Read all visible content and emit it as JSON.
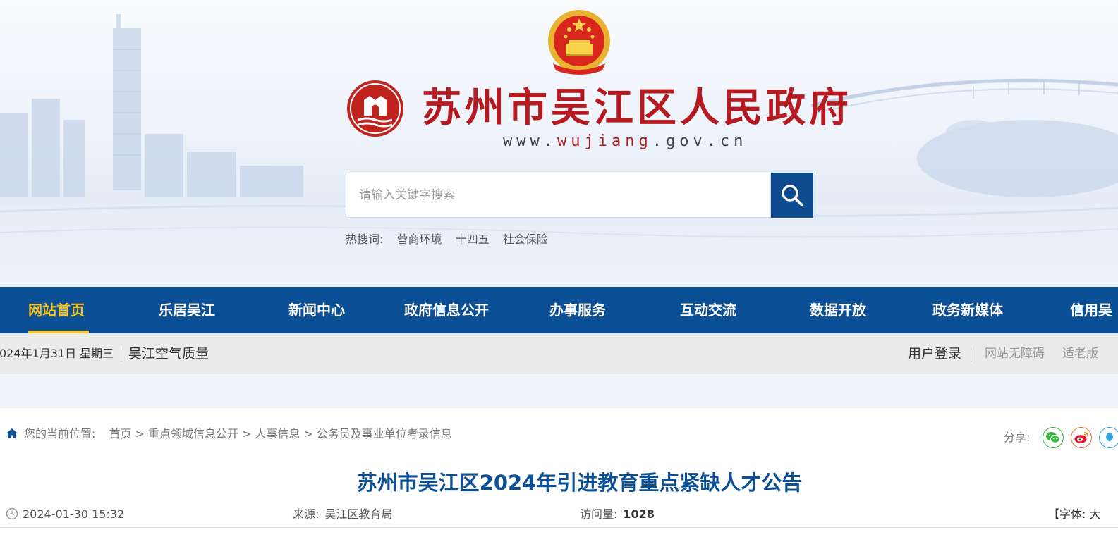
{
  "header": {
    "site_name": "苏州市吴江区人民政府",
    "url_prefix": "www.",
    "url_highlight": "wujiang",
    "url_suffix": ".gov.cn",
    "search_placeholder": "请输入关键字搜索",
    "hot_label": "热搜词:",
    "hot_words": [
      "营商环境",
      "十四五",
      "社会保险"
    ]
  },
  "nav": {
    "items": [
      "网站首页",
      "乐居吴江",
      "新闻中心",
      "政府信息公开",
      "办事服务",
      "互动交流",
      "数据开放",
      "政务新媒体",
      "信用吴"
    ],
    "active": "网站首页"
  },
  "infobar": {
    "date": "024年1月31日 星期三",
    "air_quality": "吴江空气质量",
    "login": "用户登录",
    "accessibility": "网站无障碍",
    "elder_version": "适老版"
  },
  "breadcrumb": {
    "label": "您的当前位置:",
    "items": [
      "首页",
      "重点领域信息公开",
      "人事信息",
      "公务员及事业单位考录信息"
    ],
    "separator": ">"
  },
  "share": {
    "label": "分享:",
    "icons": [
      "wechat-icon",
      "weibo-icon",
      "qq-icon"
    ]
  },
  "article": {
    "title": "苏州市吴江区2024年引进教育重点紧缺人才公告",
    "datetime": "2024-01-30 15:32",
    "source_label": "来源:",
    "source": "吴江区教育局",
    "views_label": "访问量:",
    "views": "1028",
    "font_label": "【字体:",
    "font_size_option": "大"
  },
  "colors": {
    "primary_blue": "#0b4f96",
    "active_yellow": "#f7c623",
    "brand_red": "#b41a1f",
    "infobar_bg": "#ebebeb"
  }
}
